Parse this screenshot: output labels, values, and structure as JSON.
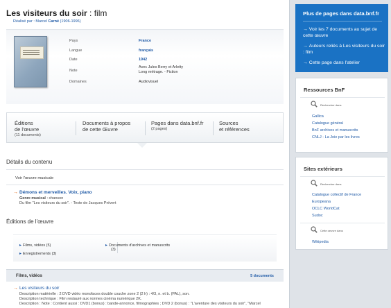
{
  "header": {
    "title": "Les visiteurs du soir",
    "title_suffix": " : film",
    "byline_prefix": "Réalisé par : Marcel ",
    "byline_name": "Carné",
    "byline_dates": " (1906-1996)"
  },
  "details": {
    "rows": [
      {
        "label": "Pays",
        "value": "France"
      },
      {
        "label": "Langue",
        "value": "français"
      },
      {
        "label": "Date",
        "value": "1942"
      },
      {
        "label": "Note",
        "value": "Avec Jules Berry et Arletty",
        "value2": "Long métrage. - Fiction"
      },
      {
        "label": "Domaines",
        "value": "Audiovisuel"
      }
    ]
  },
  "tabs": [
    {
      "label1": "Éditions",
      "label2": "de l'œuvre",
      "count": "(11 documents)"
    },
    {
      "label1": "Documents à propos",
      "label2": "de cette Œuvre"
    },
    {
      "label1": "Pages dans data.bnf.fr",
      "count": "(2 pages)"
    },
    {
      "label1": "Sources",
      "label2": "et références"
    }
  ],
  "content": {
    "details_heading": "Détails du contenu",
    "voir_heading": "Voir l'œuvre musicale",
    "item_title": "Démons et merveilles. Voix, piano",
    "genre_label": "Genre musical",
    "genre_value": " : chanson",
    "item_note": "Du film \"Les visiteurs du soir\". - Texte de Jacques Prévert",
    "editions_heading": "Éditions de l'œuvre",
    "editions": [
      {
        "label": "Films, vidéos (5)"
      },
      {
        "label": "Enregistrements (3)"
      },
      {
        "label": "Documents d'archives et manuscrits",
        "label2": "(3)"
      }
    ],
    "films_bar_label": "Films, vidéos",
    "films_bar_count": "5 documents",
    "film_title": "Les visiteurs du soir",
    "film_lines": [
      "Description matérielle : 2 DVD vidéo monofaces double couche zone 2 (2 h) : 4/3, n. et b. (PAL), son.",
      "Description technique : Film restauré aux normes cinéma numérique 2K.",
      "Description : Note : Contient aussi : DVD1 (bonus) : bande-annonce, filmographies ; DVD 2 (bonus) : \"L'aventure des visiteurs du soir\", \"Marcel"
    ]
  },
  "sidebar": {
    "promo_title": "Plus de pages dans data.bnf.fr",
    "promo_items": [
      {
        "text": "Voir les 7 documents au sujet de cette œuvre"
      },
      {
        "text": "Auteurs reliés à Les visiteurs du soir : film"
      },
      {
        "text": "Cette page dans l'atelier"
      }
    ],
    "resources": {
      "title": "Ressources BnF",
      "search_label": "Rechercher dans",
      "links": [
        "Gallica",
        "Catalogue général",
        "BnF archives et manuscrits",
        "CNLJ - La Joie par les livres"
      ]
    },
    "external": {
      "title": "Sites extérieurs",
      "search_label": "Rechercher dans",
      "links": [
        "Catalogue collectif de France",
        "Europeana",
        "OCLC WorldCat",
        "Sudoc"
      ],
      "search_label2": "Cette oeuvre dans",
      "links2": [
        "Wikipedia"
      ]
    }
  },
  "colors": {
    "accent": "#1a72c4",
    "link": "#1f5aa6",
    "arrow": "#e06a1a"
  }
}
